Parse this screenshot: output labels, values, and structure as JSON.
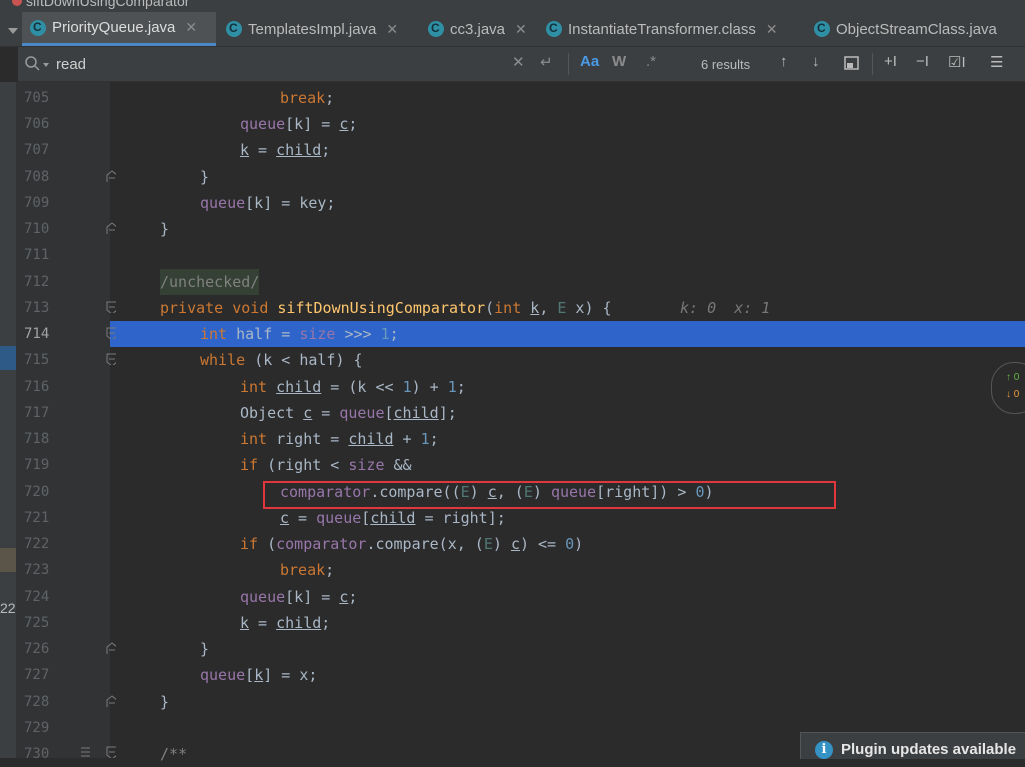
{
  "breadcrumb": {
    "method": "siftDownUsingComparator"
  },
  "tabs": [
    {
      "label": "PriorityQueue.java",
      "active": true
    },
    {
      "label": "TemplatesImpl.java",
      "active": false
    },
    {
      "label": "cc3.java",
      "active": false
    },
    {
      "label": "InstantiateTransformer.class",
      "active": false
    },
    {
      "label": "ObjectStreamClass.java",
      "active": false
    }
  ],
  "search": {
    "query": "read",
    "match_case_label": "Aa",
    "whole_words_label": "W",
    "regex_label": ".*",
    "results": "6 results"
  },
  "left_strip": {
    "number": "22"
  },
  "code": {
    "line_numbers": [
      "705",
      "706",
      "707",
      "708",
      "709",
      "710",
      "711",
      "712",
      "713",
      "714",
      "715",
      "716",
      "717",
      "718",
      "719",
      "720",
      "721",
      "722",
      "723",
      "724",
      "725",
      "726",
      "727",
      "728",
      "729",
      "730"
    ],
    "current_line": "714",
    "inlay_hint": "k: 0  x: 1",
    "annotation": "/unchecked/",
    "comment_start": "/**"
  },
  "side_widget": {
    "up": "0",
    "down": "0"
  },
  "notification": {
    "text": "Plugin updates available"
  },
  "colors": {
    "accent": "#2f65ca",
    "highlight_box": "#e0373d",
    "keyword": "#cc7832",
    "field": "#9876aa",
    "number": "#6897bb"
  }
}
